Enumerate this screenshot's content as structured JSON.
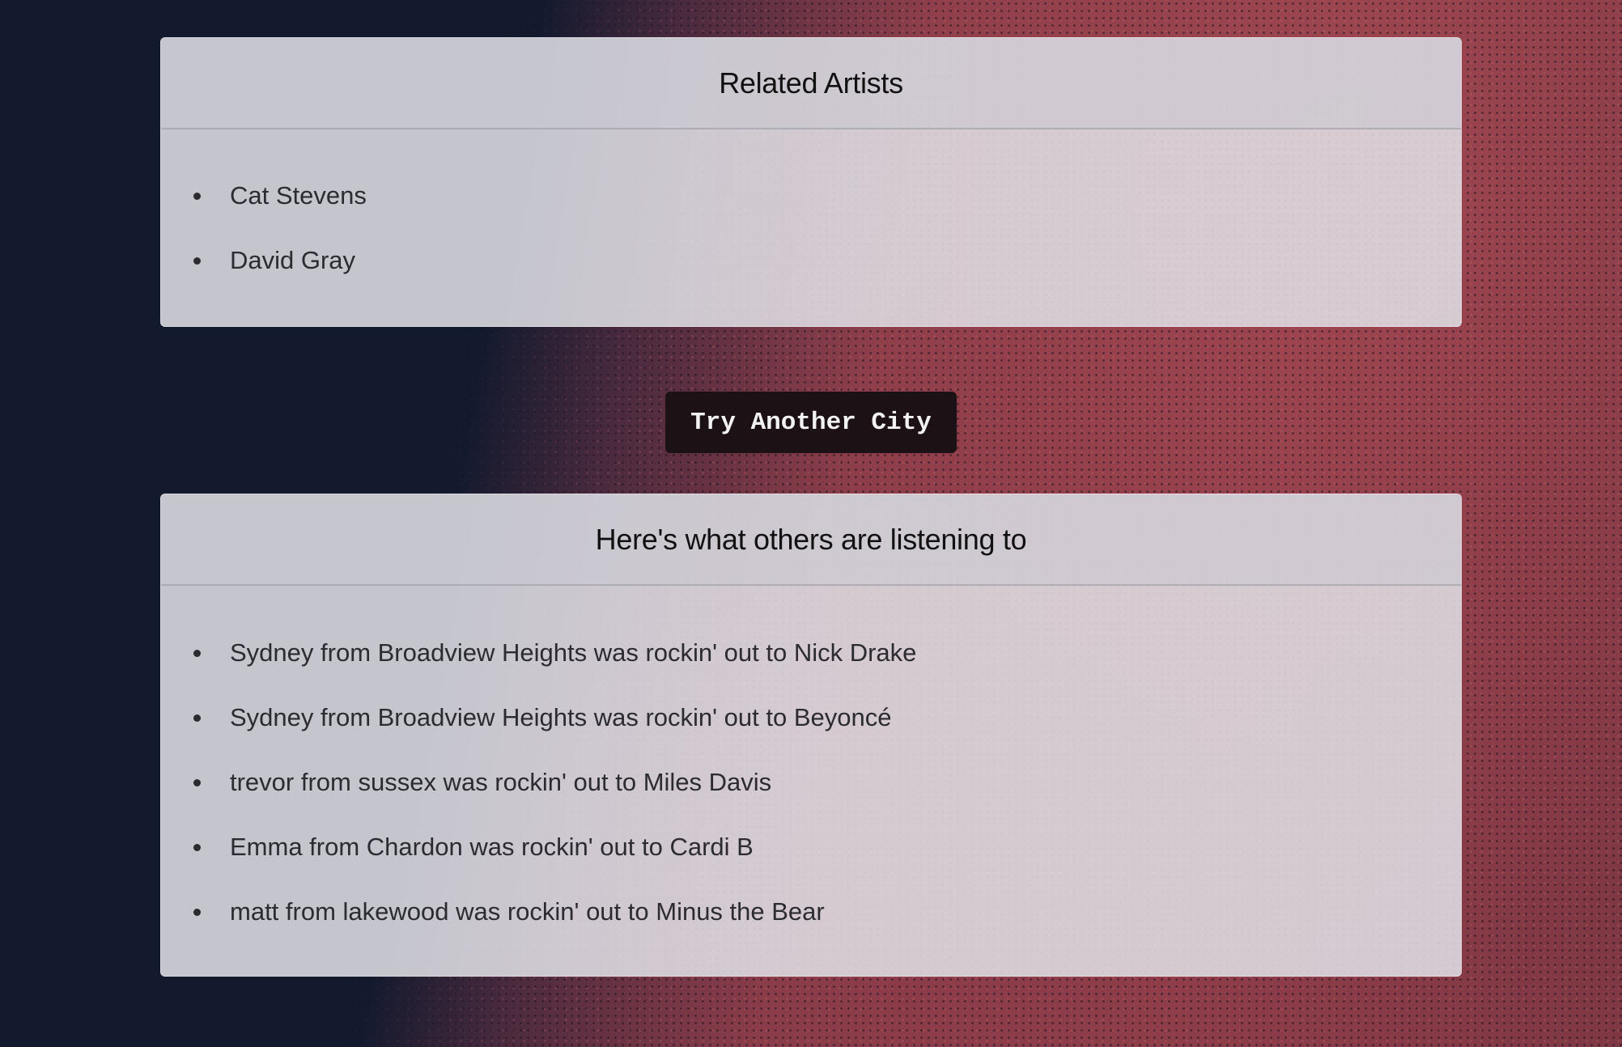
{
  "colors": {
    "page_dark": "#131a2e",
    "page_red": "#8f414b",
    "card_bg": "#e2e2e8",
    "button_bg": "#1c1114",
    "button_text": "#f2f2f2"
  },
  "related_artists": {
    "title": "Related Artists",
    "items": [
      "Cat Stevens",
      "David Gray"
    ]
  },
  "try_button": {
    "label": "Try Another City"
  },
  "others_listening": {
    "title": "Here's what others are listening to",
    "items": [
      "Sydney from Broadview Heights was rockin' out to Nick Drake",
      "Sydney from Broadview Heights was rockin' out to Beyoncé",
      "trevor from sussex was rockin' out to Miles Davis",
      "Emma from Chardon was rockin' out to Cardi B",
      "matt from lakewood was rockin' out to Minus the Bear"
    ]
  }
}
